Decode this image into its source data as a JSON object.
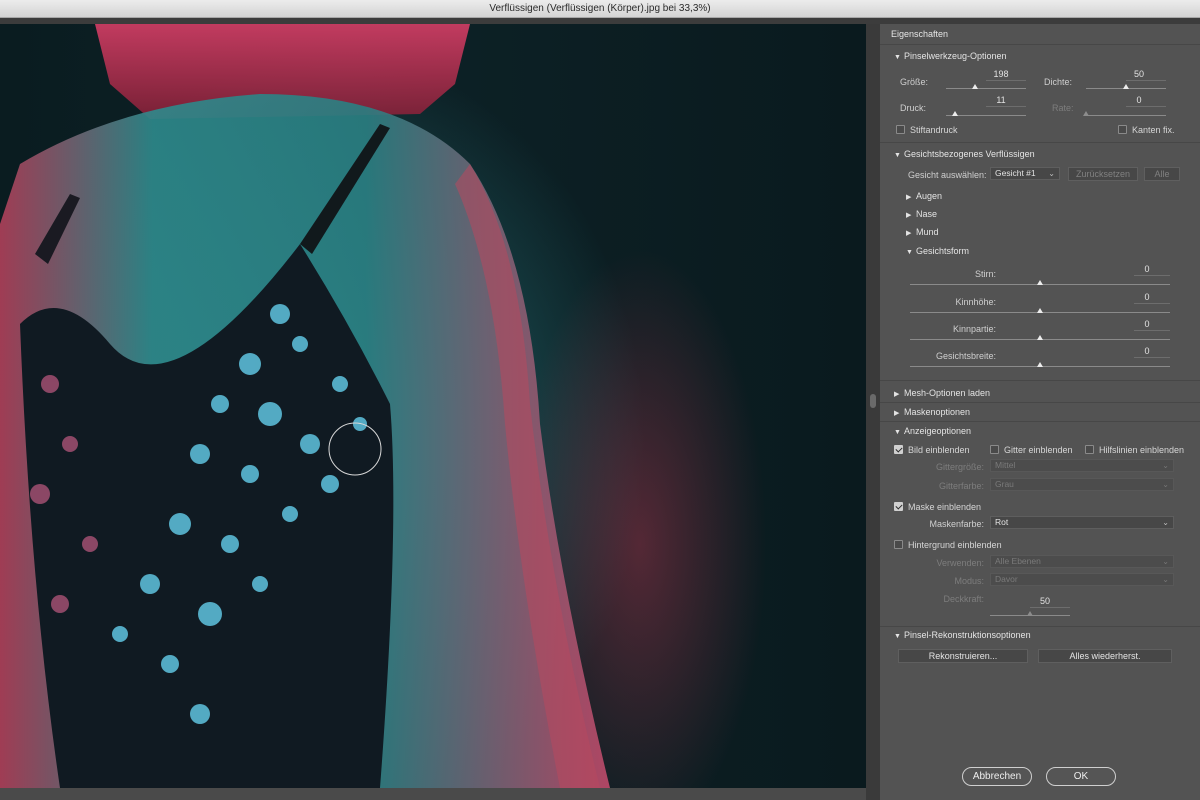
{
  "window": {
    "title": "Verflüssigen (Verflüssigen (Körper).jpg bei 33,3%)"
  },
  "colors": {
    "accent_mask": "#c23a4a",
    "panel_bg": "#535353"
  },
  "panel": {
    "title": "Eigenschaften",
    "brush_options": {
      "title": "Pinselwerkzeug-Optionen",
      "size": {
        "label": "Größe:",
        "value": "198",
        "fraction": 0.36
      },
      "density": {
        "label": "Dichte:",
        "value": "50",
        "fraction": 0.5
      },
      "pressure": {
        "label": "Druck:",
        "value": "11",
        "fraction": 0.11
      },
      "rate": {
        "label": "Rate:",
        "value": "0",
        "fraction": 0.0
      },
      "stylus_pressure": "Stiftandruck",
      "pin_edges": "Kanten fix."
    },
    "face_aware": {
      "title": "Gesichtsbezogenes Verflüssigen",
      "select_face_label": "Gesicht auswählen:",
      "select_face_value": "Gesicht #1",
      "reset_button": "Zurücksetzen",
      "all_button": "Alle",
      "eyes": "Augen",
      "nose": "Nase",
      "mouth": "Mund",
      "face_shape": "Gesichtsform",
      "forehead": {
        "label": "Stirn:",
        "value": "0",
        "fraction": 0.5
      },
      "chin_height": {
        "label": "Kinnhöhe:",
        "value": "0",
        "fraction": 0.5
      },
      "jawline": {
        "label": "Kinnpartie:",
        "value": "0",
        "fraction": 0.5
      },
      "face_width": {
        "label": "Gesichtsbreite:",
        "value": "0",
        "fraction": 0.5
      }
    },
    "load_mesh": "Mesh-Optionen laden",
    "mask_options": "Maskenoptionen",
    "view_options": {
      "title": "Anzeigeoptionen",
      "show_image": "Bild einblenden",
      "show_mesh": "Gitter einblenden",
      "show_guides": "Hilfslinien einblenden",
      "mesh_size_label": "Gittergröße:",
      "mesh_size_value": "Mittel",
      "mesh_color_label": "Gitterfarbe:",
      "mesh_color_value": "Grau",
      "show_mask": "Maske einblenden",
      "mask_color_label": "Maskenfarbe:",
      "mask_color_value": "Rot",
      "show_backdrop": "Hintergrund einblenden",
      "use_label": "Verwenden:",
      "use_value": "Alle Ebenen",
      "mode_label": "Modus:",
      "mode_value": "Davor",
      "opacity_label": "Deckkraft:",
      "opacity_value": "50",
      "opacity_fraction": 0.5
    },
    "reconstruct": {
      "title": "Pinsel-Rekonstruktionsoptionen",
      "reconstruct_button": "Rekonstruieren...",
      "restore_all_button": "Alles wiederherst."
    },
    "cancel_button": "Abbrechen",
    "ok_button": "OK"
  }
}
